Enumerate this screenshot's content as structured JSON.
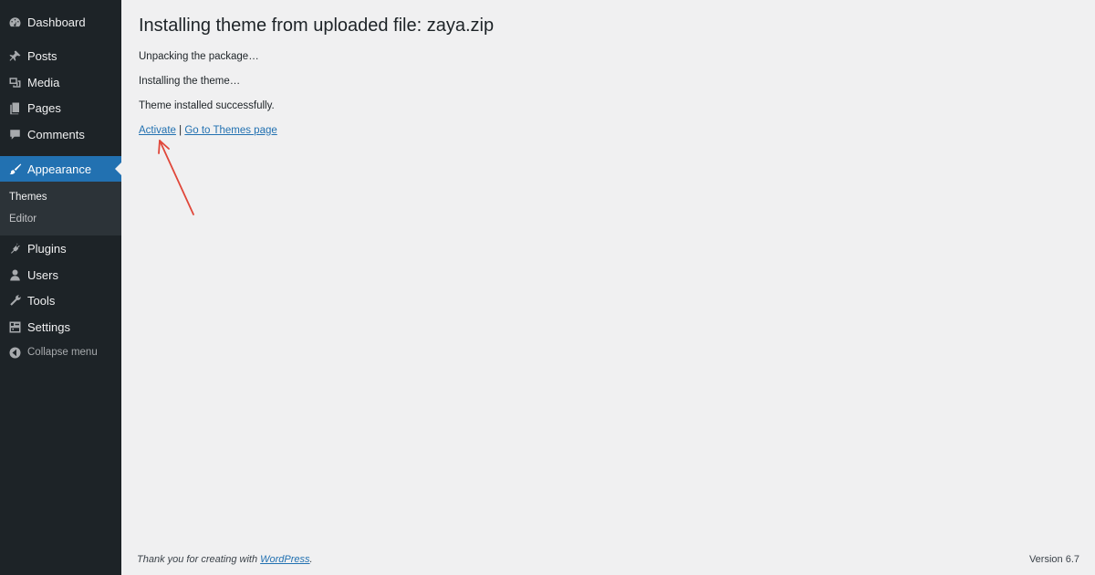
{
  "sidebar": {
    "items": [
      {
        "label": "Dashboard",
        "icon": "dashboard-icon"
      },
      {
        "label": "Posts",
        "icon": "pushpin-icon"
      },
      {
        "label": "Media",
        "icon": "media-icon"
      },
      {
        "label": "Pages",
        "icon": "pages-icon"
      },
      {
        "label": "Comments",
        "icon": "comment-icon"
      },
      {
        "label": "Appearance",
        "icon": "paintbrush-icon",
        "active": true
      },
      {
        "label": "Plugins",
        "icon": "plug-icon"
      },
      {
        "label": "Users",
        "icon": "user-icon"
      },
      {
        "label": "Tools",
        "icon": "wrench-icon"
      },
      {
        "label": "Settings",
        "icon": "settings-icon"
      }
    ],
    "submenu": [
      {
        "label": "Themes"
      },
      {
        "label": "Editor"
      }
    ],
    "collapse_label": "Collapse menu"
  },
  "main": {
    "title": "Installing theme from uploaded file: zaya.zip",
    "messages": [
      "Unpacking the package…",
      "Installing the theme…",
      "Theme installed successfully."
    ],
    "links": {
      "activate": "Activate",
      "separator": "|",
      "themes_page": "Go to Themes page"
    }
  },
  "footer": {
    "thanks_prefix": "Thank you for creating with",
    "wordpress_link": "WordPress",
    "thanks_suffix": ".",
    "version": "Version 6.7"
  },
  "colors": {
    "sidebar_bg": "#1d2327",
    "submenu_bg": "#2c3338",
    "active_bg": "#2271b1",
    "page_bg": "#f0f0f1",
    "link": "#2271b1",
    "annotation_arrow": "#e0473a"
  }
}
